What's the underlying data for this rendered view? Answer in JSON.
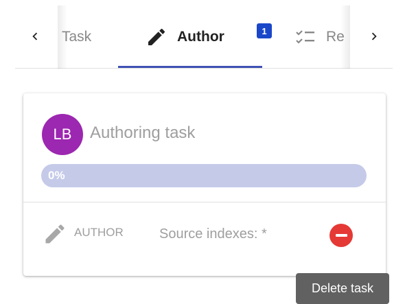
{
  "tabs": {
    "items": [
      {
        "label": "Task",
        "icon": "task-icon"
      },
      {
        "label": "Author",
        "icon": "pencil-icon",
        "badge": "1",
        "active": true
      },
      {
        "label": "Re",
        "icon": "review-checklist-icon"
      }
    ],
    "nav_prev_icon": "chevron-left-icon",
    "nav_next_icon": "chevron-right-icon",
    "active_color": "#3f51b5"
  },
  "card": {
    "avatar_initials": "LB",
    "avatar_color": "#9c27b0",
    "title": "Authoring task",
    "progress": {
      "label": "0%",
      "value": 0
    },
    "role_icon": "pencil-icon",
    "role_label": "AUTHOR",
    "source_text": "Source indexes: *",
    "delete_icon": "remove-circle-icon",
    "delete_color": "#e53935"
  },
  "tooltip": {
    "text": "Delete task"
  }
}
